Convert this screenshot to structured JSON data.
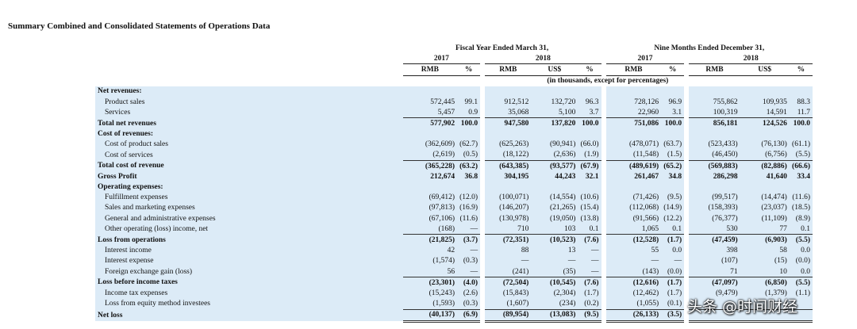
{
  "title": "Summary Combined and Consolidated Statements of Operations Data",
  "header": {
    "period_fy": "Fiscal Year Ended March 31,",
    "period_nm": "Nine Months Ended December 31,",
    "years": [
      "2017",
      "2018",
      "2017",
      "2018"
    ],
    "units": [
      "RMB",
      "%",
      "RMB",
      "US$",
      "%",
      "RMB",
      "%",
      "RMB",
      "US$",
      "%"
    ],
    "note": "(in thousands, except for percentages)"
  },
  "rows": [
    {
      "label": "Net revenues:",
      "kind": "section",
      "vals": []
    },
    {
      "label": "Product sales",
      "kind": "item",
      "vals": [
        "572,445",
        "99.1",
        "912,512",
        "132,720",
        "96.3",
        "728,126",
        "96.9",
        "755,862",
        "109,935",
        "88.3"
      ]
    },
    {
      "label": "Services",
      "kind": "item",
      "vals": [
        "5,457",
        "0.9",
        "35,068",
        "5,100",
        "3.7",
        "22,960",
        "3.1",
        "100,319",
        "14,591",
        "11.7"
      ]
    },
    {
      "label": "Total net revenues",
      "kind": "total",
      "vals": [
        "577,902",
        "100.0",
        "947,580",
        "137,820",
        "100.0",
        "751,086",
        "100.0",
        "856,181",
        "124,526",
        "100.0"
      ]
    },
    {
      "label": "Cost of revenues:",
      "kind": "section",
      "vals": []
    },
    {
      "label": "Cost of product sales",
      "kind": "item",
      "vals": [
        "(362,609)",
        "(62.7)",
        "(625,263)",
        "(90,941)",
        "(66.0)",
        "(478,071)",
        "(63.7)",
        "(523,433)",
        "(76,130)",
        "(61.1)"
      ]
    },
    {
      "label": "Cost of services",
      "kind": "item",
      "vals": [
        "(2,619)",
        "(0.5)",
        "(18,122)",
        "(2,636)",
        "(1.9)",
        "(11,548)",
        "(1.5)",
        "(46,450)",
        "(6,756)",
        "(5.5)"
      ]
    },
    {
      "label": "Total cost of revenue",
      "kind": "total",
      "vals": [
        "(365,228)",
        "(63.2)",
        "(643,385)",
        "(93,577)",
        "(67.9)",
        "(489,619)",
        "(65.2)",
        "(569,883)",
        "(82,886)",
        "(66.6)"
      ]
    },
    {
      "label": "Gross Profit",
      "kind": "bold",
      "vals": [
        "212,674",
        "36.8",
        "304,195",
        "44,243",
        "32.1",
        "261,467",
        "34.8",
        "286,298",
        "41,640",
        "33.4"
      ]
    },
    {
      "label": "Operating expenses:",
      "kind": "section",
      "vals": []
    },
    {
      "label": "Fulfillment expenses",
      "kind": "item",
      "vals": [
        "(69,412)",
        "(12.0)",
        "(100,071)",
        "(14,554)",
        "(10.6)",
        "(71,426)",
        "(9.5)",
        "(99,517)",
        "(14,474)",
        "(11.6)"
      ]
    },
    {
      "label": "Sales and marketing expenses",
      "kind": "item",
      "vals": [
        "(97,813)",
        "(16.9)",
        "(146,207)",
        "(21,265)",
        "(15.4)",
        "(112,068)",
        "(14.9)",
        "(158,393)",
        "(23,037)",
        "(18.5)"
      ]
    },
    {
      "label": "General and administrative expenses",
      "kind": "item",
      "vals": [
        "(67,106)",
        "(11.6)",
        "(130,978)",
        "(19,050)",
        "(13.8)",
        "(91,566)",
        "(12.2)",
        "(76,377)",
        "(11,109)",
        "(8.9)"
      ]
    },
    {
      "label": "Other operating (loss) income, net",
      "kind": "item",
      "vals": [
        "(168)",
        "—",
        "710",
        "103",
        "0.1",
        "1,065",
        "0.1",
        "530",
        "77",
        "0.1"
      ]
    },
    {
      "label": "Loss from operations",
      "kind": "total",
      "vals": [
        "(21,825)",
        "(3.7)",
        "(72,351)",
        "(10,523)",
        "(7.6)",
        "(12,528)",
        "(1.7)",
        "(47,459)",
        "(6,903)",
        "(5.5)"
      ]
    },
    {
      "label": "Interest income",
      "kind": "item",
      "vals": [
        "42",
        "—",
        "88",
        "13",
        "—",
        "55",
        "0.0",
        "398",
        "58",
        "0.0"
      ]
    },
    {
      "label": "Interest expense",
      "kind": "item",
      "vals": [
        "(1,574)",
        "(0.3)",
        "—",
        "—",
        "—",
        "—",
        "—",
        "(107)",
        "(15)",
        "(0.0)"
      ]
    },
    {
      "label": "Foreign exchange gain (loss)",
      "kind": "item",
      "vals": [
        "56",
        "—",
        "(241)",
        "(35)",
        "—",
        "(143)",
        "(0.0)",
        "71",
        "10",
        "0.0"
      ]
    },
    {
      "label": "Loss before income taxes",
      "kind": "total",
      "vals": [
        "(23,301)",
        "(4.0)",
        "(72,504)",
        "(10,545)",
        "(7.6)",
        "(12,616)",
        "(1.7)",
        "(47,097)",
        "(6,850)",
        "(5.5)"
      ]
    },
    {
      "label": "Income tax expenses",
      "kind": "item",
      "vals": [
        "(15,243)",
        "(2.6)",
        "(15,843)",
        "(2,304)",
        "(1.7)",
        "(12,462)",
        "(1.7)",
        "(9,479)",
        "(1,379)",
        "(1.1)"
      ]
    },
    {
      "label": "Loss from equity method investees",
      "kind": "item",
      "vals": [
        "(1,593)",
        "(0.3)",
        "(1,607)",
        "(234)",
        "(0.2)",
        "(1,055)",
        "(0.1)",
        "",
        "",
        ""
      ]
    },
    {
      "label": "Net loss",
      "kind": "final",
      "vals": [
        "(40,137)",
        "(6.9)",
        "(89,954)",
        "(13,083)",
        "(9.5)",
        "(26,133)",
        "(3.5)",
        "",
        "",
        ""
      ]
    }
  ],
  "watermark": "头条 @时间财经"
}
